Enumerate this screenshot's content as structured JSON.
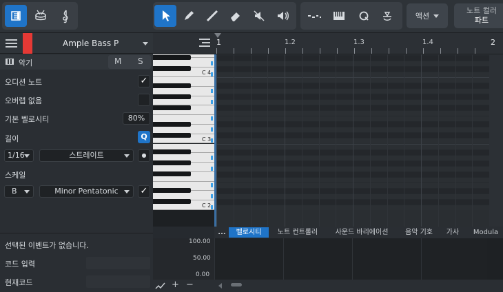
{
  "toolbar": {
    "left_group": [
      "inspector-toggle",
      "drum-editor",
      "score-editor"
    ],
    "tools": [
      "arrow",
      "pencil",
      "paint",
      "eraser",
      "mute",
      "listen"
    ],
    "note_tools": [
      "step",
      "keyboard",
      "quantize",
      "transform"
    ],
    "action_label": "액션",
    "note_color_label": "노트 컬러",
    "note_color_value": "파트"
  },
  "track": {
    "name": "Ample Bass P",
    "color": "#e53935"
  },
  "inspector": {
    "instrument_label": "악기",
    "m_label": "M",
    "s_label": "S",
    "audition_label": "오디션 노트",
    "audition_checked": true,
    "no_overlap_label": "오버랩 없음",
    "no_overlap_checked": false,
    "default_velocity_label": "기본 벨로시티",
    "default_velocity_value": "80%",
    "length_label": "길이",
    "quantize_button": "Q",
    "length_value": "1/16",
    "mode_value": "스트레이트",
    "scale_label": "스케일",
    "scale_root": "B",
    "scale_type": "Minor Pentatonic",
    "scale_checked": true
  },
  "piano": {
    "c4": "C 4",
    "c3": "C 3",
    "c2": "C 2"
  },
  "ruler": {
    "marks": [
      "1",
      "1.2",
      "1.3",
      "1.4",
      "2"
    ]
  },
  "lane_tabs": {
    "more": "...",
    "items": [
      "벨로시티",
      "노트 컨트롤러",
      "사운드 바리에이션",
      "음악 기호",
      "가사",
      "Modula"
    ],
    "active": 0
  },
  "velocity": {
    "ticks": [
      "100.00",
      "50.00",
      "0.00"
    ]
  },
  "bottom_panel": {
    "no_selection": "선택된 이벤트가 없습니다.",
    "chord_input_label": "코드 입력",
    "current_chord_label": "현재코드"
  },
  "lane_controls": [
    "add-curve",
    "+",
    "−"
  ],
  "colors": {
    "accent": "#1f74c8",
    "track_color": "#e53935"
  }
}
